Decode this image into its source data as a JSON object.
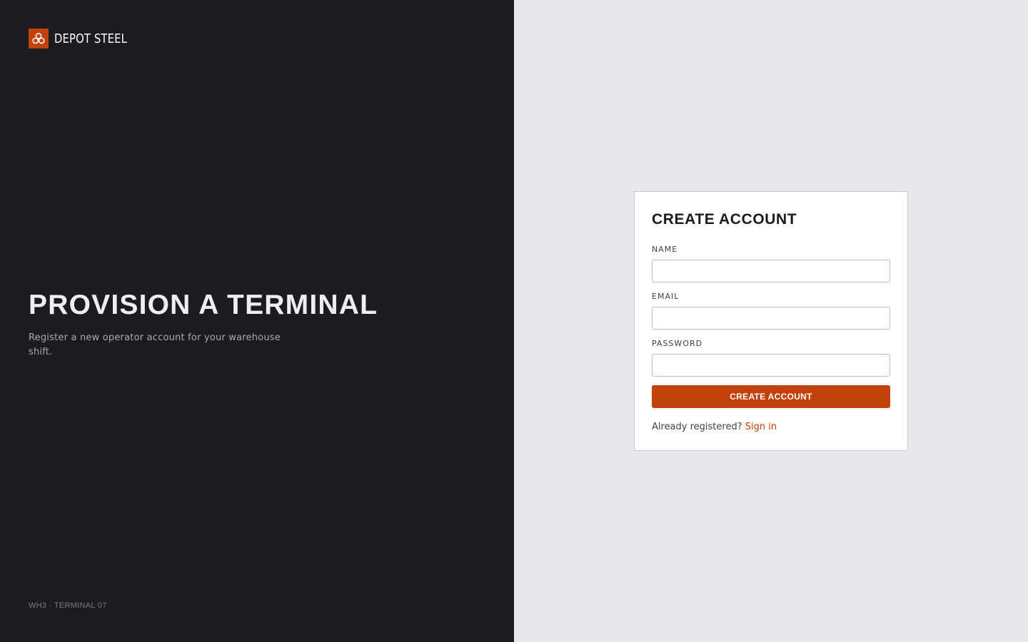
{
  "brand": {
    "name": "DEPOT STEEL",
    "logo_icon": "box-cluster-icon",
    "accent_color": "#c2410c"
  },
  "hero": {
    "title": "PROVISION A TERMINAL",
    "subtitle": "Register a new operator account for your warehouse shift."
  },
  "footer": {
    "terminal_id": "WH3 · TERMINAL 07"
  },
  "form": {
    "title": "CREATE ACCOUNT",
    "fields": [
      {
        "label": "NAME",
        "value": "",
        "placeholder": ""
      },
      {
        "label": "EMAIL",
        "value": "",
        "placeholder": ""
      },
      {
        "label": "PASSWORD",
        "value": "",
        "placeholder": ""
      }
    ],
    "submit_label": "CREATE ACCOUNT",
    "signin_prompt": "Already registered?",
    "signin_link": "Sign in"
  }
}
